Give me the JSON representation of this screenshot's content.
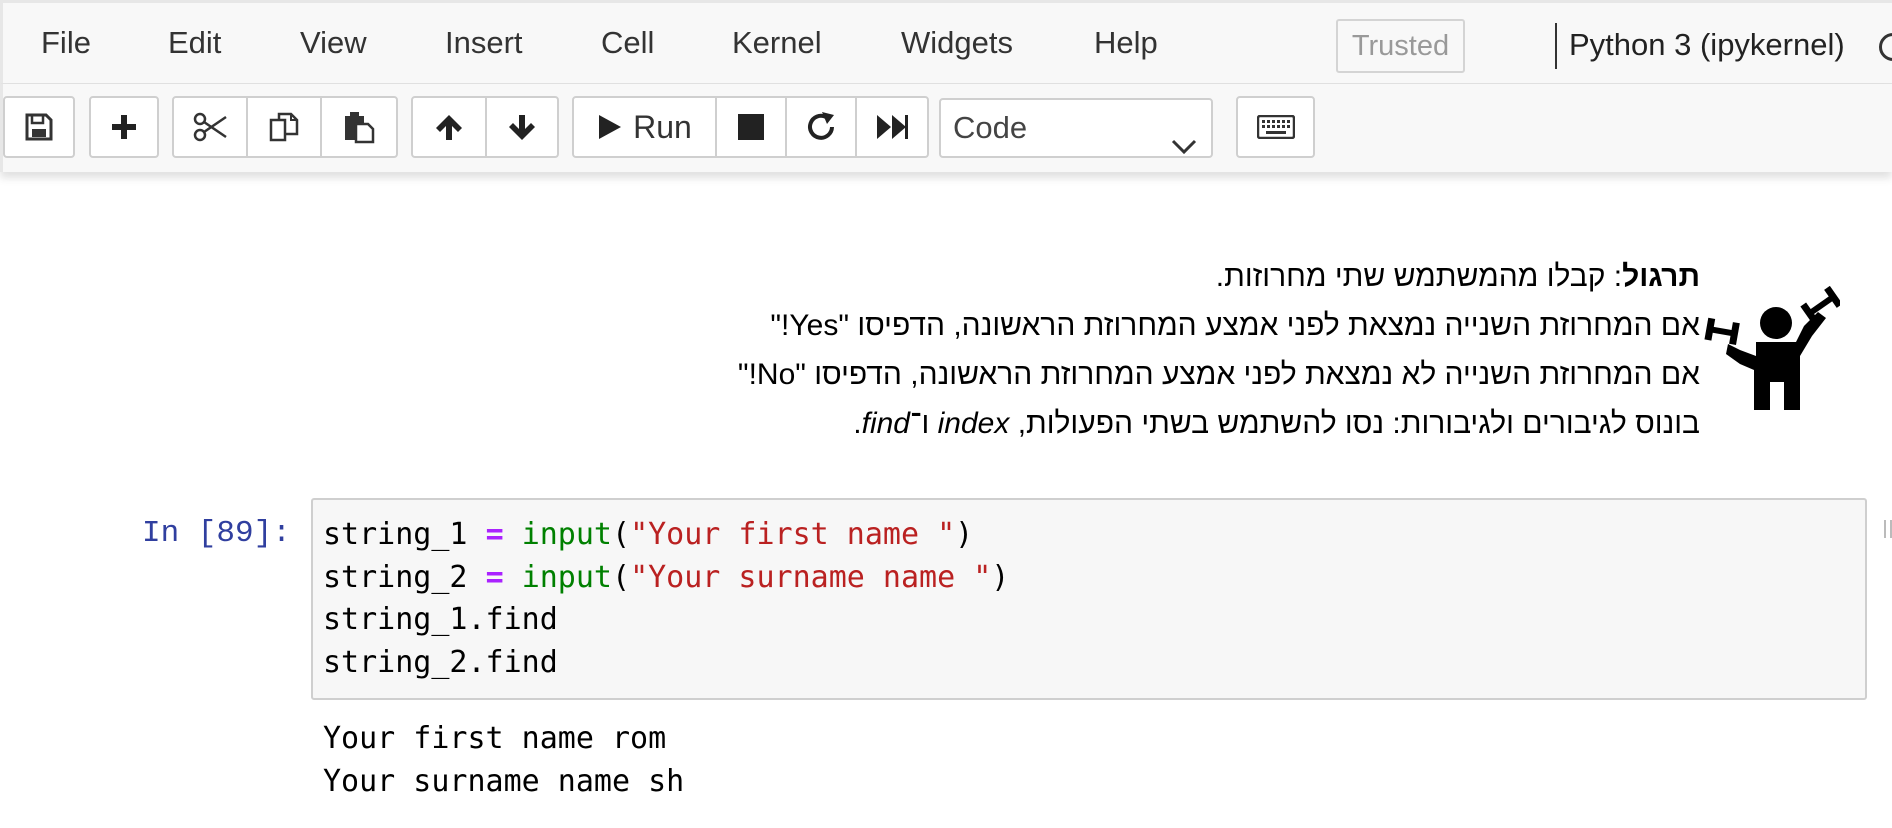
{
  "menubar": {
    "items": [
      "File",
      "Edit",
      "View",
      "Insert",
      "Cell",
      "Kernel",
      "Widgets",
      "Help"
    ],
    "trusted": "Trusted",
    "kernel_name": "Python 3 (ipykernel)"
  },
  "toolbar": {
    "run_label": "Run",
    "cell_type": "Code"
  },
  "icons": {
    "save": "save-icon",
    "insert": "plus-icon",
    "cut": "scissors-icon",
    "copy": "copy-icon",
    "paste": "paste-icon",
    "move_up": "arrow-up-icon",
    "move_down": "arrow-down-icon",
    "run": "play-icon",
    "interrupt": "stop-icon",
    "restart": "restart-icon",
    "run_all": "fast-forward-icon",
    "keyboard": "keyboard-icon",
    "exercise": "weightlifter-icon"
  },
  "colors": {
    "prompt": "#303f9f",
    "keyword_builtin": "#008000",
    "string": "#ba2121",
    "operator": "#aa22ff",
    "partial_circle": "#d63a2f"
  },
  "markdown": {
    "line1_bold": "תרגול",
    "line1_rest": ": קבלו מהמשתמש שתי מחרוזות.",
    "line2": "אם המחרוזת השנייה נמצאת לפני אמצע המחרוזת הראשונה, הדפיסו \"Yes!\"",
    "line3": "אם המחרוזת השנייה לא נמצאת לפני אמצע המחרוזת הראשונה, הדפיסו \"No!\"",
    "line4_pre": "בונוס לגיבורים ולגיבורות: נסו להשתמש בשתי הפעולות,",
    "line4_index": "index",
    "line4_mid": "ו־",
    "line4_find": "find",
    "line4_end": "."
  },
  "cell": {
    "prompt": "In [89]:",
    "code": {
      "l1_var": "string_1",
      "l1_op": "=",
      "l1_fn": "input",
      "l1_str": "\"Your first name \"",
      "l2_var": "string_2",
      "l2_op": "=",
      "l2_fn": "input",
      "l2_str": "\"Your surname name \"",
      "l3": "string_1.find",
      "l4": "string_2.find"
    },
    "output": [
      "Your first name rom",
      "Your surname name sh"
    ]
  }
}
